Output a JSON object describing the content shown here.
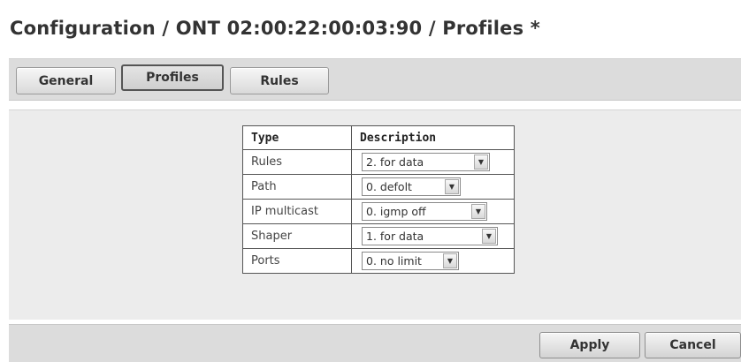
{
  "page_title": "Configuration / ONT 02:00:22:00:03:90 / Profiles *",
  "tabs": [
    {
      "label": "General",
      "active": false
    },
    {
      "label": "Profiles",
      "active": true
    },
    {
      "label": "Rules",
      "active": false
    }
  ],
  "table": {
    "headers": {
      "type": "Type",
      "description": "Description"
    },
    "rows": [
      {
        "type": "Rules",
        "value": "2. for data"
      },
      {
        "type": "Path",
        "value": "0. defolt"
      },
      {
        "type": "IP multicast",
        "value": "0. igmp off"
      },
      {
        "type": "Shaper",
        "value": "1. for data"
      },
      {
        "type": "Ports",
        "value": "0. no limit"
      }
    ]
  },
  "icons": {
    "dropdown": "chevron-down-icon"
  },
  "footer": {
    "apply_label": "Apply",
    "cancel_label": "Cancel"
  }
}
